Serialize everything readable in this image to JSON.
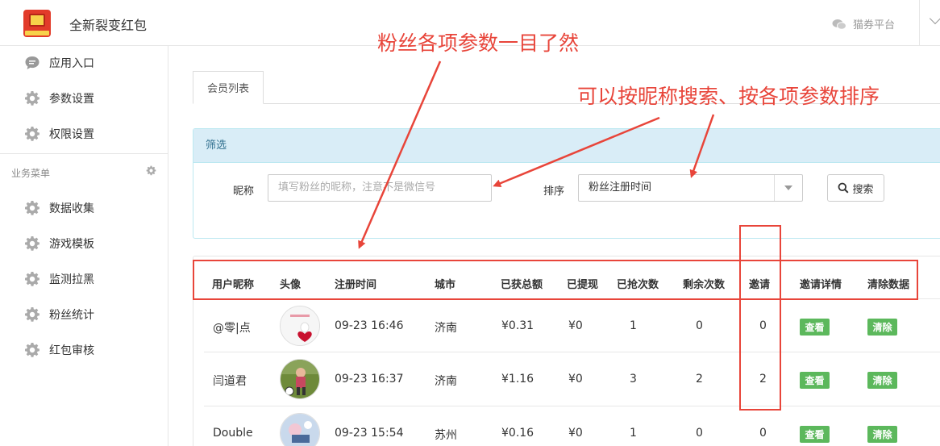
{
  "header": {
    "app_title": "全新裂变红包",
    "platform_label": "猫券平台"
  },
  "sidebar": {
    "items_top": [
      {
        "label": "应用入口",
        "icon": "chat-icon"
      },
      {
        "label": "参数设置",
        "icon": "gear-icon"
      },
      {
        "label": "权限设置",
        "icon": "gear-icon"
      }
    ],
    "section_title": "业务菜单",
    "items_business": [
      {
        "label": "数据收集",
        "icon": "gear-icon"
      },
      {
        "label": "游戏模板",
        "icon": "gear-icon"
      },
      {
        "label": "监测拉黑",
        "icon": "gear-icon"
      },
      {
        "label": "粉丝统计",
        "icon": "gear-icon"
      },
      {
        "label": "红包审核",
        "icon": "gear-icon"
      }
    ]
  },
  "tabs": [
    {
      "label": "会员列表",
      "active": true
    }
  ],
  "filter": {
    "title": "筛选",
    "nickname_label": "昵称",
    "nickname_placeholder": "填写粉丝的昵称，注意不是微信号",
    "sort_label": "排序",
    "sort_value": "粉丝注册时间",
    "search_label": "搜索"
  },
  "table": {
    "columns": [
      "用户昵称",
      "头像",
      "注册时间",
      "城市",
      "已获总额",
      "已提现",
      "已抢次数",
      "剩余次数",
      "邀请",
      "邀请详情",
      "清除数据"
    ],
    "rows": [
      {
        "nickname": "@零|点",
        "time": "09-23 16:46",
        "city": "济南",
        "total": "¥0.31",
        "withdrawn": "¥0",
        "grabbed": "1",
        "remaining": "0",
        "invites": "0",
        "detail": "查看",
        "clear": "清除"
      },
      {
        "nickname": "闫道君",
        "time": "09-23 16:37",
        "city": "济南",
        "total": "¥1.16",
        "withdrawn": "¥0",
        "grabbed": "3",
        "remaining": "2",
        "invites": "2",
        "detail": "查看",
        "clear": "清除"
      },
      {
        "nickname": "Double",
        "time": "09-23 15:54",
        "city": "苏州",
        "total": "¥0.16",
        "withdrawn": "¥0",
        "grabbed": "1",
        "remaining": "0",
        "invites": "0",
        "detail": "查看",
        "clear": "清除"
      }
    ]
  },
  "annotations": {
    "top": "粉丝各项参数一目了然",
    "right": "可以按昵称搜索、按各项参数排序"
  },
  "colors": {
    "annotation_red": "#e8453a",
    "button_green": "#5cb85c",
    "panel_header": "#d9edf7"
  }
}
